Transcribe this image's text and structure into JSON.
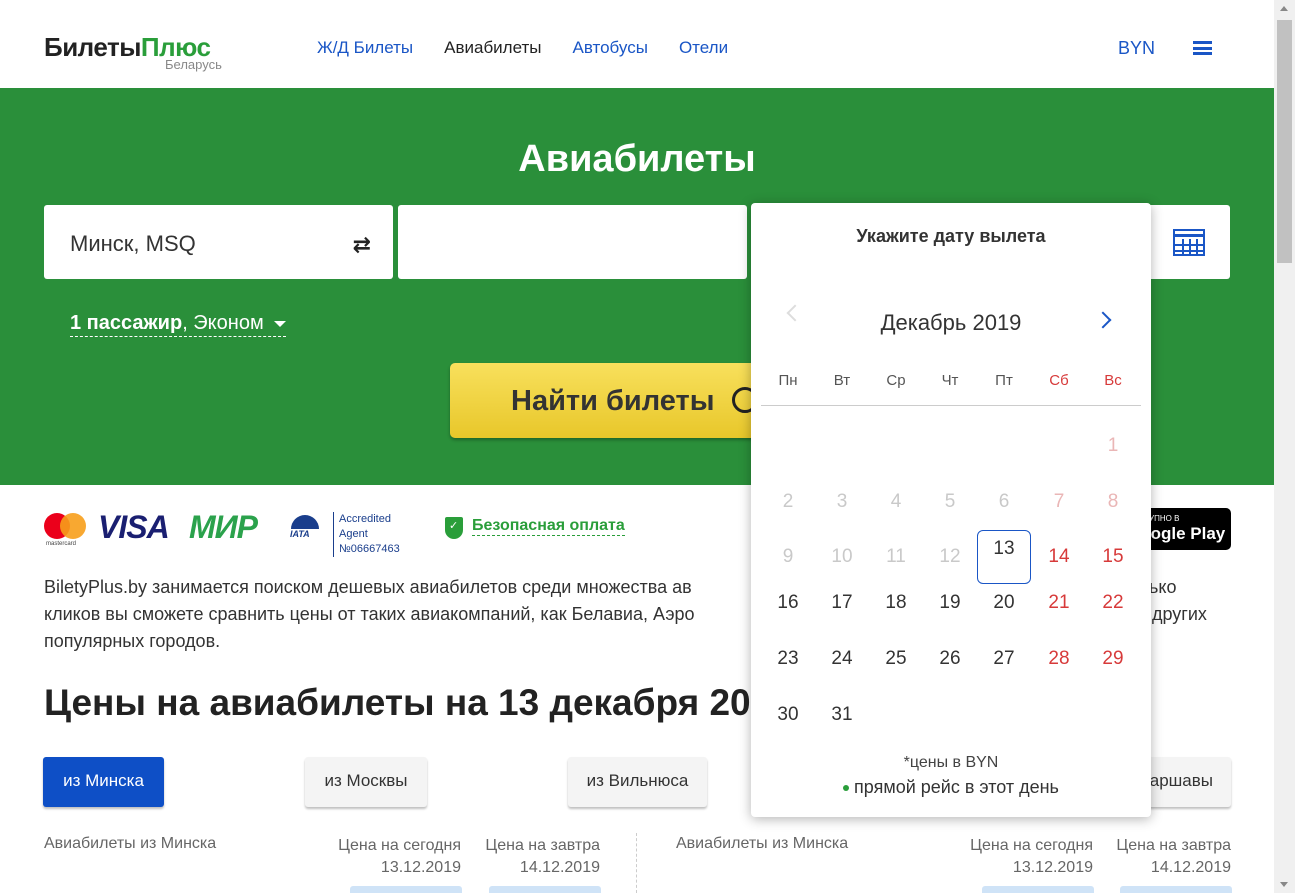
{
  "header": {
    "logo_part1": "Билеты",
    "logo_part2": "Плюс",
    "logo_sub": "Беларусь",
    "nav": [
      "Ж/Д Билеты",
      "Авиабилеты",
      "Автобусы",
      "Отели"
    ],
    "currency": "BYN"
  },
  "hero": {
    "title": "Авиабилеты",
    "from_value": "Минск, MSQ",
    "passengers_bold": "1 пассажир",
    "passengers_class": ", Эконом",
    "search_label": "Найти билеты"
  },
  "payments": {
    "mastercard_text": "mastercard",
    "visa": "VISA",
    "mir": "МИР",
    "iata_word": "IATA",
    "iata_line1": "Accredited Agent",
    "iata_line2": "№06667463",
    "secure": "Безопасная оплата",
    "gplay_small": "ДОСТУПНО В",
    "gplay_big": "Google Play"
  },
  "description": "BiletyPlus.by занимается поиском дешевых авиабилетов среди множества ав                                                                                    сколько кликов вы сможете сравнить цены от таких авиакомпаний, как Белавиа, Аэро                                                                              инска и других популярных городов.",
  "prices_title": "Цены на авиабилеты на 13 декабря 20",
  "city_buttons": [
    "из Минска",
    "из Москвы",
    "из Вильнюса",
    "аршавы"
  ],
  "columns": {
    "left_label": "Авиабилеты из Минска",
    "right_label": "Авиабилеты из Минска",
    "today_label": "Цена на сегодня",
    "today_date": "13.12.2019",
    "tomorrow_label": "Цена на завтра",
    "tomorrow_date": "14.12.2019"
  },
  "calendar": {
    "title": "Укажите дату вылета",
    "month": "Декабрь 2019",
    "weekdays": [
      "Пн",
      "Вт",
      "Ср",
      "Чт",
      "Пт",
      "Сб",
      "Вс"
    ],
    "selected_day": 13,
    "footnote": "*цены в BYN",
    "legend": "прямой рейс в этот день"
  },
  "colors": {
    "brand_green": "#2a8f3a",
    "link_blue": "#1a56c6",
    "weekend_red": "#d73a3a",
    "button_yellow": "#f0d03c"
  }
}
